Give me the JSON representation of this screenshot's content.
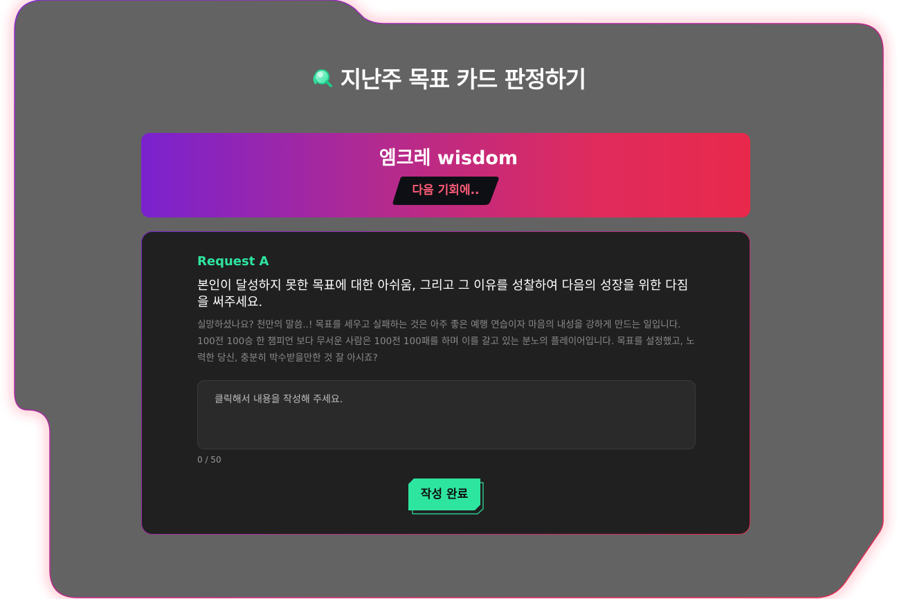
{
  "page": {
    "title": "지난주 목표 카드 판정하기",
    "title_icon": "magnifier-icon"
  },
  "wisdom": {
    "title": "엠크레 wisdom",
    "verdict": "다음 기회에.."
  },
  "request": {
    "label": "Request A",
    "question": "본인이 달성하지 못한 목표에 대한 아쉬움, 그리고 그 이유를 성찰하여 다음의 성장을 위한 다짐을 써주세요.",
    "guide": "실망하셨나요? 천만의 말씀..! 목표를 세우고 실패하는 것은 아주 좋은 예행 연습이자 마음의 내성을 강하게 만드는 일입니다. 100전 100승 한 챔피언 보다 무서운 사람은 100전 100패를 하며 이를 갈고 있는 분노의 플레이어입니다. 목표를 설정했고, 노력한 당신, 충분히 박수받을만한 것 잘 아시죠?",
    "input_placeholder": "클릭해서 내용을 작성해 주세요.",
    "input_value": "",
    "char_count": "0 / 50",
    "submit_label": "작성 완료"
  },
  "colors": {
    "frame_bg": "#636363",
    "card_bg": "#202020",
    "accent_green": "#2ee5a0",
    "gradient_start": "#7a22cf",
    "gradient_end": "#e8294c",
    "verdict_text": "#ff5c78"
  }
}
